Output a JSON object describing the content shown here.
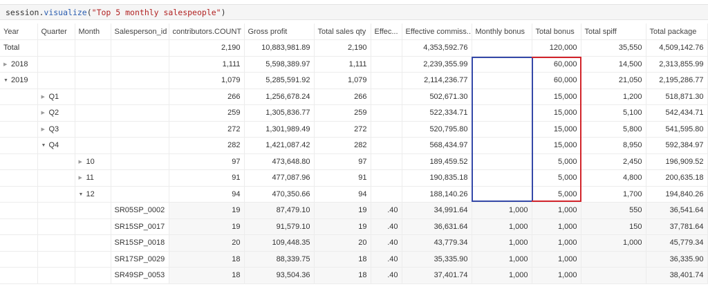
{
  "code": {
    "object": "session",
    "method": "visualize",
    "argument": "\"Top 5 monthly salespeople\""
  },
  "headers": [
    "Year",
    "Quarter",
    "Month",
    "Salesperson_id",
    "contributors.COUNT",
    "Gross profit",
    "Total sales qty",
    "Effec...",
    "Effective commiss...",
    "Monthly bonus",
    "Total bonus",
    "Total spiff",
    "Total package"
  ],
  "rows": [
    {
      "indent": 0,
      "label": "Total",
      "tri": "",
      "kind": "total",
      "cells": [
        "2,190",
        "10,883,981.89",
        "2,190",
        "",
        "4,353,592.76",
        "",
        "120,000",
        "35,550",
        "4,509,142.76"
      ]
    },
    {
      "indent": 0,
      "label": "2018",
      "tri": "closed",
      "kind": "group",
      "cells": [
        "1,111",
        "5,598,389.97",
        "1,111",
        "",
        "2,239,355.99",
        "",
        "60,000",
        "14,500",
        "2,313,855.99"
      ]
    },
    {
      "indent": 0,
      "label": "2019",
      "tri": "open",
      "kind": "group",
      "cells": [
        "1,079",
        "5,285,591.92",
        "1,079",
        "",
        "2,114,236.77",
        "",
        "60,000",
        "21,050",
        "2,195,286.77"
      ]
    },
    {
      "indent": 1,
      "label": "Q1",
      "tri": "closed",
      "kind": "group",
      "cells": [
        "266",
        "1,256,678.24",
        "266",
        "",
        "502,671.30",
        "",
        "15,000",
        "1,200",
        "518,871.30"
      ]
    },
    {
      "indent": 1,
      "label": "Q2",
      "tri": "closed",
      "kind": "group",
      "cells": [
        "259",
        "1,305,836.77",
        "259",
        "",
        "522,334.71",
        "",
        "15,000",
        "5,100",
        "542,434.71"
      ]
    },
    {
      "indent": 1,
      "label": "Q3",
      "tri": "closed",
      "kind": "group",
      "cells": [
        "272",
        "1,301,989.49",
        "272",
        "",
        "520,795.80",
        "",
        "15,000",
        "5,800",
        "541,595.80"
      ]
    },
    {
      "indent": 1,
      "label": "Q4",
      "tri": "open",
      "kind": "group",
      "cells": [
        "282",
        "1,421,087.42",
        "282",
        "",
        "568,434.97",
        "",
        "15,000",
        "8,950",
        "592,384.97"
      ]
    },
    {
      "indent": 2,
      "label": "10",
      "tri": "closed",
      "kind": "group",
      "cells": [
        "97",
        "473,648.80",
        "97",
        "",
        "189,459.52",
        "",
        "5,000",
        "2,450",
        "196,909.52"
      ]
    },
    {
      "indent": 2,
      "label": "11",
      "tri": "closed",
      "kind": "group",
      "cells": [
        "91",
        "477,087.96",
        "91",
        "",
        "190,835.18",
        "",
        "5,000",
        "4,800",
        "200,635.18"
      ]
    },
    {
      "indent": 2,
      "label": "12",
      "tri": "open",
      "kind": "group",
      "cells": [
        "94",
        "470,350.66",
        "94",
        "",
        "188,140.26",
        "",
        "5,000",
        "1,700",
        "194,840.26"
      ]
    },
    {
      "indent": 3,
      "label": "SR05SP_0002",
      "tri": "",
      "kind": "leaf",
      "cells": [
        "19",
        "87,479.10",
        "19",
        ".40",
        "34,991.64",
        "1,000",
        "1,000",
        "550",
        "36,541.64"
      ]
    },
    {
      "indent": 3,
      "label": "SR15SP_0017",
      "tri": "",
      "kind": "leaf",
      "cells": [
        "19",
        "91,579.10",
        "19",
        ".40",
        "36,631.64",
        "1,000",
        "1,000",
        "150",
        "37,781.64"
      ]
    },
    {
      "indent": 3,
      "label": "SR15SP_0018",
      "tri": "",
      "kind": "leaf",
      "cells": [
        "20",
        "109,448.35",
        "20",
        ".40",
        "43,779.34",
        "1,000",
        "1,000",
        "1,000",
        "45,779.34"
      ]
    },
    {
      "indent": 3,
      "label": "SR17SP_0029",
      "tri": "",
      "kind": "leaf",
      "cells": [
        "18",
        "88,339.75",
        "18",
        ".40",
        "35,335.90",
        "1,000",
        "1,000",
        "",
        "36,335.90"
      ]
    },
    {
      "indent": 3,
      "label": "SR49SP_0053",
      "tri": "",
      "kind": "leaf",
      "cells": [
        "18",
        "93,504.36",
        "18",
        ".40",
        "37,401.74",
        "1,000",
        "1,000",
        "",
        "38,401.74"
      ]
    }
  ],
  "highlights": {
    "monthly_bonus_color": "#3448a8",
    "total_bonus_color": "#d2232a"
  }
}
